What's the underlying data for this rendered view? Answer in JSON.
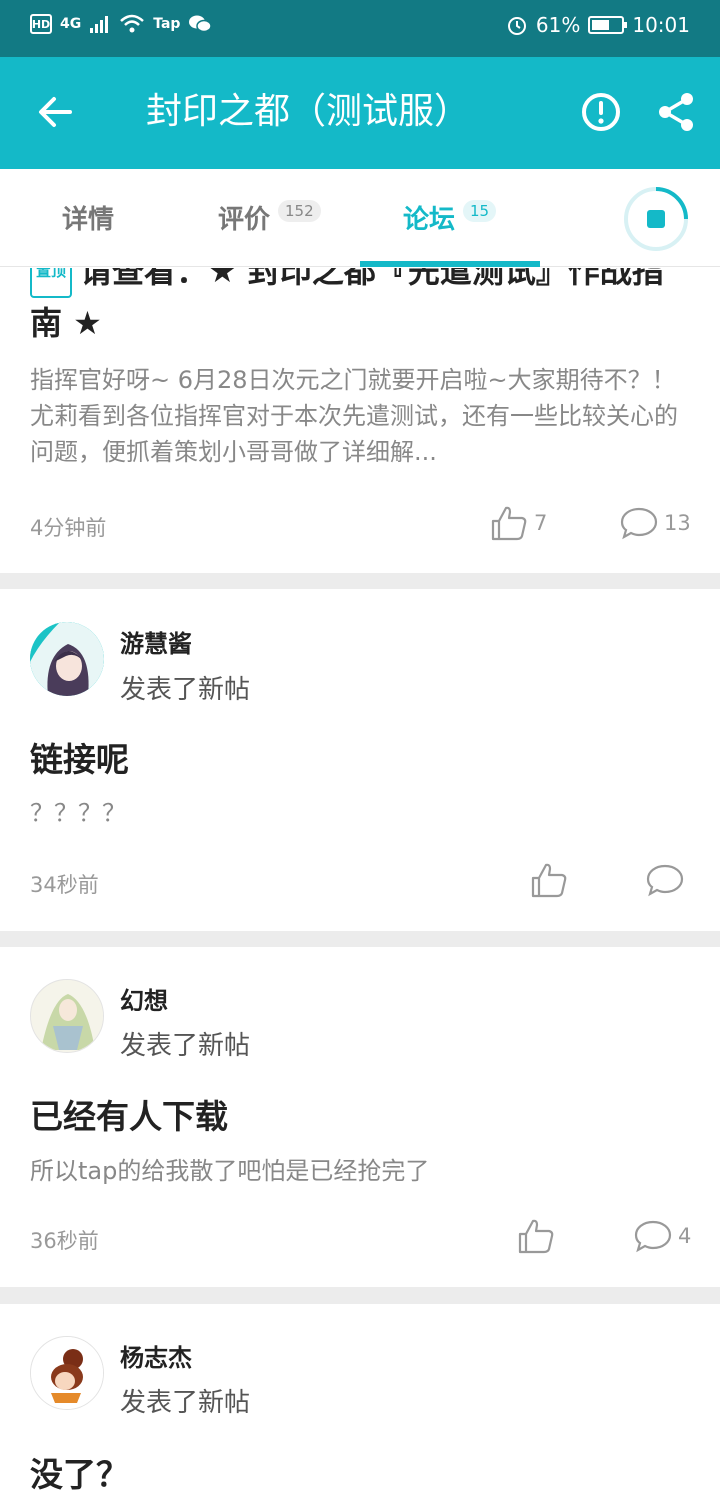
{
  "status_bar": {
    "hd": "HD",
    "network": "4G",
    "tap": "Tap",
    "battery": "61%",
    "battery_level": 0.61,
    "time": "10:01"
  },
  "app_bar": {
    "title": "封印之都（测试服）",
    "color": "#14b9c8"
  },
  "tabs": [
    {
      "label": "详情",
      "count": ""
    },
    {
      "label": "评价",
      "count": "152"
    },
    {
      "label": "论坛",
      "count": "15",
      "active": true
    }
  ],
  "pinned_post": {
    "badge": "置顶",
    "title": "请查看：★ 封印之都『先遣测试』作战指南 ★",
    "excerpt": "指挥官好呀~ 6月28日次元之门就要开启啦~大家期待不？！ 尤莉看到各位指挥官对于本次先遣测试，还有一些比较关心的问题，便抓着策划小哥哥做了详细解...",
    "time": "4分钟前",
    "likes": "7",
    "comments": "13"
  },
  "posts": [
    {
      "author": "游慧酱",
      "action": "发表了新帖",
      "title": "链接呢",
      "body": "？？？？",
      "time": "34秒前",
      "likes": "",
      "comments": ""
    },
    {
      "author": "幻想",
      "action": "发表了新帖",
      "title": "已经有人下载",
      "body": "所以tap的给我散了吧怕是已经抢完了",
      "time": "36秒前",
      "likes": "",
      "comments": "4"
    },
    {
      "author": "杨志杰",
      "action": "发表了新帖",
      "title": "没了？",
      "body": "",
      "time": "",
      "likes": "",
      "comments": ""
    }
  ]
}
